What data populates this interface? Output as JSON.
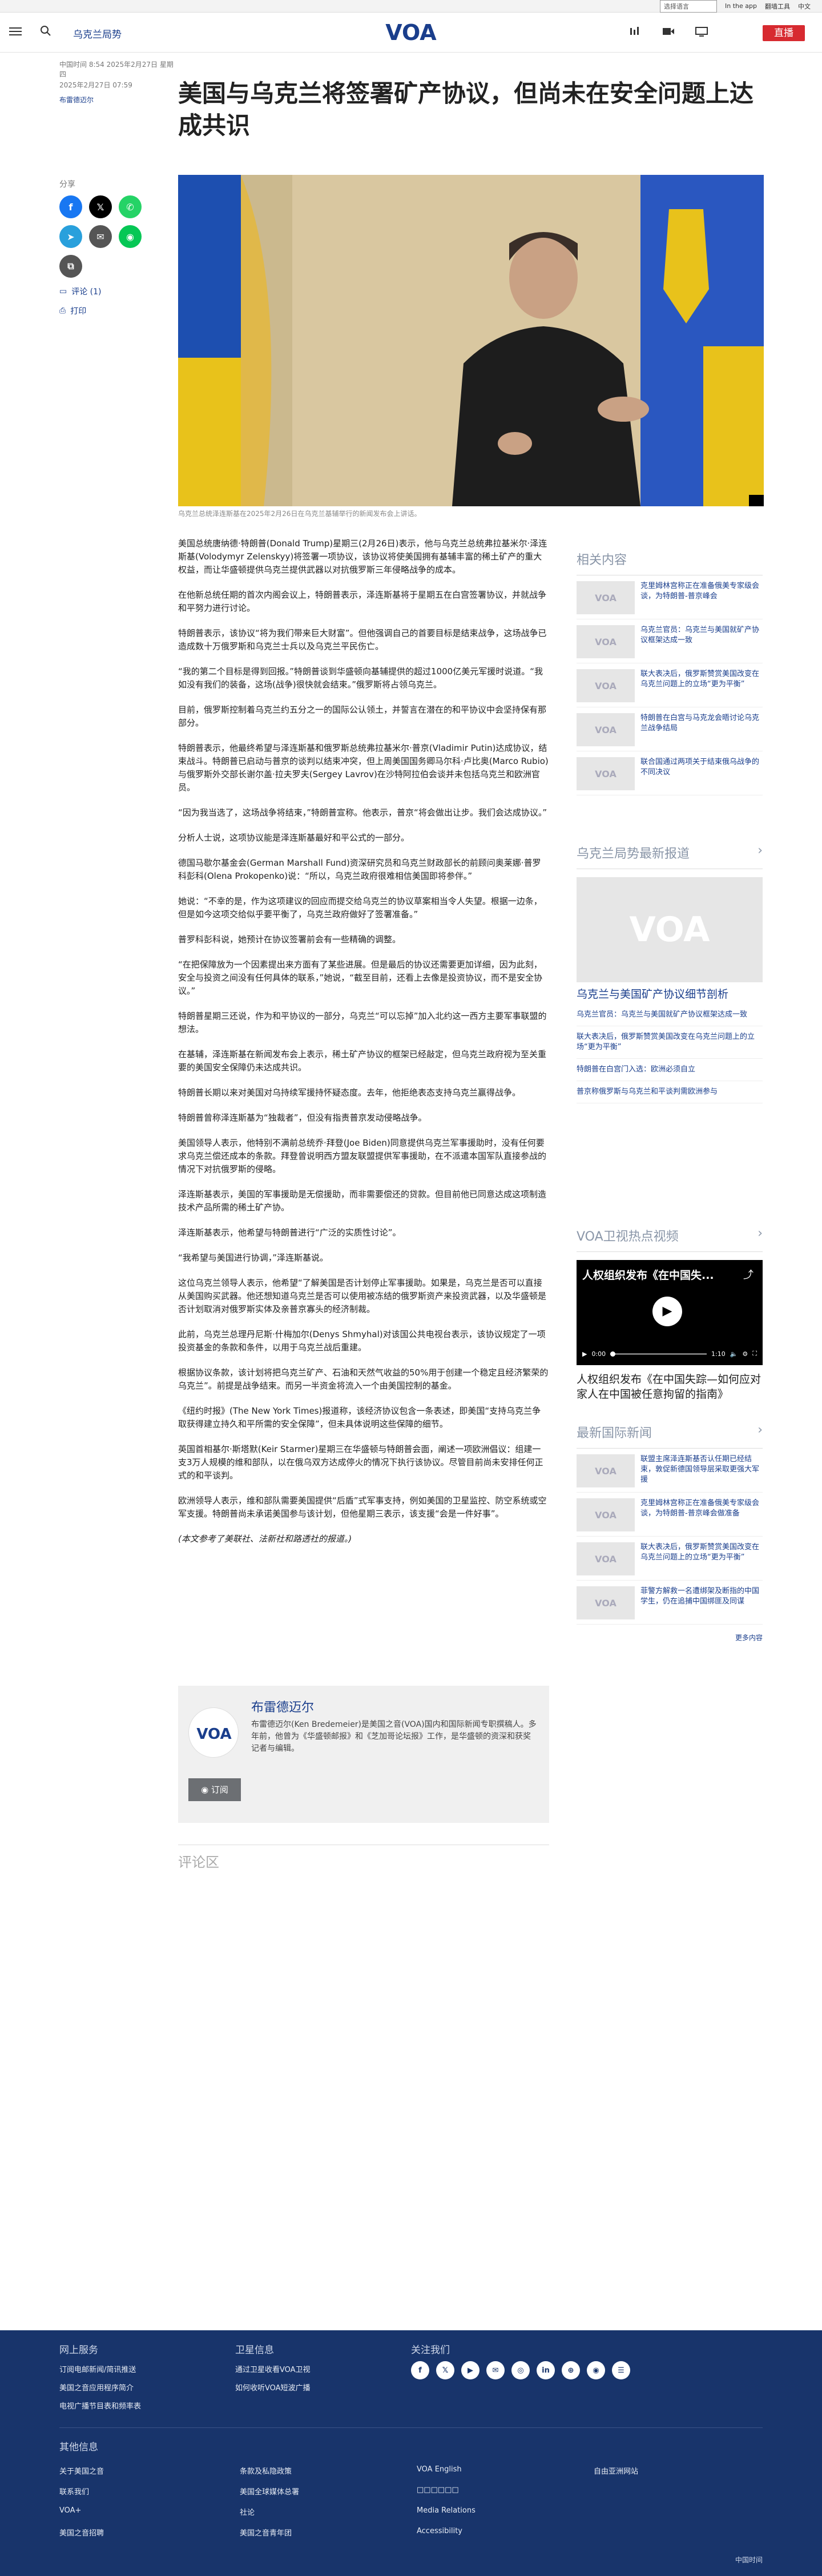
{
  "topbar": {
    "language_select": "选择语言",
    "links": [
      "In the app",
      "翻墙工具",
      "中文"
    ]
  },
  "header": {
    "section": "乌克兰局势",
    "live_label": "直播",
    "logo_text": "VOA"
  },
  "meta": {
    "timestamp": "中国时间 8:54 2025年2月27日 星期四",
    "updated": "2025年2月27日 07:59",
    "author": "布雷德迈尔"
  },
  "article": {
    "title": "美国与乌克兰将签署矿产协议，但尚未在安全问题上达成共识",
    "caption": "乌克兰总统泽连斯基在2025年2月26日在乌克兰基辅举行的新闻发布会上讲话。",
    "paragraphs": [
      "美国总统唐纳德·特朗普(Donald Trump)星期三(2月26日)表示，他与乌克兰总统弗拉基米尔·泽连斯基(Volodymyr Zelenskyy)将签署一项协议，该协议将使美国拥有基辅丰富的稀土矿产的重大权益，而让华盛顿提供乌克兰提供武器以对抗俄罗斯三年侵略战争的成本。",
      "在他新总统任期的首次内阁会议上，特朗普表示，泽连斯基将于星期五在白宫签署协议，并就战争和平努力进行讨论。",
      "特朗普表示，该协议“将为我们带来巨大财富”。但他强调自己的首要目标是结束战争，这场战争已造成数十万俄罗斯和乌克兰士兵以及乌克兰平民伤亡。",
      "“我的第二个目标是得到回报。”特朗普谈到华盛顿向基辅提供的超过1000亿美元军援时说道。“我如没有我们的装备，这场(战争)很快就会结束。”俄罗斯将占领乌克兰。",
      "目前，俄罗斯控制着乌克兰约五分之一的国际公认领土，并誓言在潜在的和平协议中会坚持保有那部分。",
      "特朗普表示，他最终希望与泽连斯基和俄罗斯总统弗拉基米尔·普京(Vladimir Putin)达成协议，结束战斗。特朗普已启动与普京的谈判以结束冲突，但上周美国国务卿马尔科·卢比奥(Marco Rubio)与俄罗斯外交部长谢尔盖·拉夫罗夫(Sergey Lavrov)在沙特阿拉伯会谈并未包括乌克兰和欧洲官员。",
      "“因为我当选了，这场战争将结束，”特朗普宣称。他表示，普京“将会做出让步。我们会达成协议。”",
      "分析人士说，这项协议能是泽连斯基最好和平公式的一部分。",
      "德国马歇尔基金会(German Marshall Fund)资深研究员和乌克兰财政部长的前顾问奥莱娜·普罗科彭科(Olena Prokopenko)说：“所以，乌克兰政府很难相信美国即将参伴。”",
      "她说：“不幸的是，作为这项建议的回应而提交给乌克兰的协议草案相当令人失望。根据一边条，但是如今这项交给似乎要平衡了，乌克兰政府做好了签署准备。”",
      "普罗科彭科说，她预计在协议签署前会有一些精确的调整。",
      "“在把保障放为一个因素提出来方面有了某些进展。但是最后的协议还需要更加详细，因为此刻，安全与投资之间没有任何具体的联系，”她说，“截至目前，还看上去像是投资协议，而不是安全协议。”",
      "特朗普星期三还说，作为和平协议的一部分，乌克兰“可以忘掉”加入北约这一西方主要军事联盟的想法。",
      "在基辅，泽连斯基在新闻发布会上表示，稀土矿产协议的框架已经敲定，但乌克兰政府视为至关重要的美国安全保障仍未达成共识。",
      "特朗普长期以来对美国对乌持续军援持怀疑态度。去年，他拒绝表态支持乌克兰赢得战争。",
      "特朗普曾称泽连斯基为“独裁者”，但没有指责普京发动侵略战争。",
      "美国领导人表示，他特别不满前总统乔·拜登(Joe Biden)同意提供乌克兰军事援助时，没有任何要求乌克兰偿还成本的条款。拜登曾说明西方盟友联盟提供军事援助，在不派遣本国军队直接参战的情况下对抗俄罗斯的侵略。",
      "泽连斯基表示，美国的军事援助是无偿援助，而非需要偿还的贷款。但目前他已同意达成这项制造技术产品所需的稀土矿产协。",
      "泽连斯基表示，他希望与特朗普进行“广泛的实质性讨论”。",
      "“我希望与美国进行协调，”泽连斯基说。",
      "这位乌克兰领导人表示，他希望“了解美国是否计划停止军事援助。如果是，乌克兰是否可以直接从美国购买武器。他还想知道乌克兰是否可以使用被冻结的俄罗斯资产来投资武器，以及华盛顿是否计划取消对俄罗斯实体及亲普京寡头的经济制裁。",
      "此前，乌克兰总理丹尼斯·什梅加尔(Denys Shmyhal)对该国公共电视台表示，该协议规定了一项投资基金的条款和条件，以用于乌克兰战后重建。",
      "根据协议条款，该计划将把乌克兰矿产、石油和天然气收益的50%用于创建一个稳定且经济繁荣的乌克兰”。前提是战争结束。而另一半资金将流入一个由美国控制的基金。",
      "《纽约时报》(The New York Times)报道称，该经济协议包含一条表述，即美国“支持乌克兰争取获得建立持久和平所需的安全保障”，但未具体说明这些保障的细节。",
      "英国首相基尔·斯塔默(Keir Starmer)星期三在华盛顿与特朗普会面，阐述一项欧洲倡议：组建一支3万人规模的维和部队，以在俄乌双方达成停火的情况下执行该协议。尽管目前尚未安排任何正式的和平谈判。",
      "欧洲领导人表示，维和部队需要美国提供“后盾”式军事支持，例如美国的卫星监控、防空系统或空军支援。特朗普尚未承诺美国参与该计划，但他星期三表示，该支援“会是一件好事”。"
    ],
    "note": "(本文参考了美联社、法新社和路透社的报道。)"
  },
  "share": {
    "label": "分享",
    "comments": "评论 (1)",
    "print": "打印"
  },
  "author_box": {
    "name": "布雷德迈尔",
    "bio": "布雷德迈尔(Ken Bredemeier)是美国之音(VOA)国内和国际新闻专职撰稿人。多年前，他曾为《华盛顿邮报》和《芝加哥论坛报》工作，是华盛顿的资深和获奖记者与编辑。",
    "subscribe": "订阅"
  },
  "comments_title": "评论区",
  "sidebar": {
    "related_title": "相关内容",
    "related": [
      "克里姆林宫称正在准备俄美专家级会谈，为特朗普-普京峰会",
      "乌克兰官员：乌克兰与美国就矿产协议框架达成一致",
      "联大表决后，俄罗斯赞赏美国改变在乌克兰问题上的立场“更为平衡”",
      "特朗普在白宫与马克龙会晤讨论乌克兰战争结局",
      "联合国通过两项关于结束俄乌战争的不同决议"
    ],
    "latest_title": "乌克兰局势最新报道",
    "latest_head": "乌克兰与美国矿产协议细节剖析",
    "latest_list": [
      "乌克兰官员：乌克兰与美国就矿产协议框架达成一致",
      "联大表决后，俄罗斯赞赏美国改变在乌克兰问题上的立场“更为平衡”",
      "特朗普在白宫门入选：欧洲必须自立",
      "普京称俄罗斯与乌克兰和平谈判需欧洲参与"
    ],
    "video_title": "VOA卫视热点视频",
    "video_overlay": "人权组织发布《在中国失...",
    "video_time_now": "0:00",
    "video_time_total": "1:10",
    "video_caption": "人权组织发布《在中国失踪—如何应对家人在中国被任意拘留的指南》",
    "world_title": "最新国际新闻",
    "world": [
      "联盟主席泽连斯基否认任期已经结束，敦促新德国领导层采取更强大军援",
      "克里姆林宫称正在准备俄美专家级会谈，为特朗普-普京峰会做准备",
      "联大表决后，俄罗斯赞赏美国改变在乌克兰问题上的立场“更为平衡”",
      "菲警方解救一名遭绑架及断指的中国学生，仍在追捕中国绑匪及同谋"
    ],
    "more": "更多内容"
  },
  "footer": {
    "col1_title": "网上服务",
    "col1": [
      "订阅电邮新闻/简讯推送",
      "美国之音应用程序简介",
      "电视广播节目表和频率表"
    ],
    "col2_title": "卫星信息",
    "col2": [
      "通过卫星收看VOA卫视",
      "如何收听VOA短波广播"
    ],
    "col3_title": "关注我们",
    "social": [
      "f",
      "𝕏",
      "▶",
      "✉",
      "◎",
      "in",
      "⊕",
      "◉",
      "☰"
    ],
    "other_title": "其他信息",
    "other": [
      [
        "关于美国之音",
        "条款及私隐政策",
        "VOA English",
        "自由亚洲网站"
      ],
      [
        "联系我们",
        "美国全球媒体总署",
        "□□□□□□",
        ""
      ],
      [
        "VOA+",
        "社论",
        "Media Relations",
        ""
      ],
      [
        "美国之音招聘",
        "美国之音青年团",
        "Accessibility",
        ""
      ]
    ],
    "copyright": "中国时间"
  }
}
